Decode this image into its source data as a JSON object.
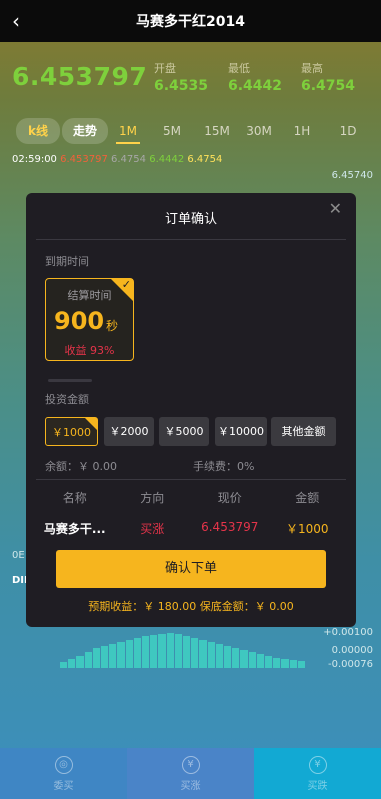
{
  "header": {
    "back_icon": "chevron-left-icon",
    "title": "马赛多干红2014"
  },
  "price": {
    "current": "6.453797",
    "open_label": "开盘",
    "open": "6.4535",
    "low_label": "最低",
    "low": "6.4442",
    "high_label": "最高",
    "high": "6.4754"
  },
  "tabs": [
    "k线",
    "走势",
    "1M",
    "5M",
    "15M",
    "30M",
    "1H",
    "1D"
  ],
  "ticker": {
    "time": "02:59:00",
    "open": "6.453797",
    "high": "6.4754",
    "low": "6.4442",
    "close": "6.4754"
  },
  "axis": {
    "top": "6.45740",
    "r1": "+0.00100",
    "r2": "0.00000",
    "r3": "-0.00076"
  },
  "chart_fragment": {
    "left_a": "0E",
    "left_b": "DII"
  },
  "bottom_nav": [
    "委买",
    "买涨",
    "买跌"
  ],
  "modal": {
    "title": "订单确认",
    "close_icon": "close-icon",
    "expiry_label": "到期时间",
    "time_card": {
      "label": "结算时间",
      "value": "900",
      "unit": "秒",
      "yield": "收益 93%"
    },
    "amount_label": "投资金额",
    "amounts": [
      "￥1000",
      "￥2000",
      "￥5000",
      "￥10000",
      "其他金额"
    ],
    "balance": "余额：￥ 0.00",
    "fee": "手续费：0%",
    "table": {
      "headers": [
        "名称",
        "方向",
        "现价",
        "金额"
      ],
      "row": {
        "name": "马赛多干...",
        "direction": "买涨",
        "price": "6.453797",
        "amount": "￥1000"
      }
    },
    "confirm_label": "确认下单",
    "summary": "预期收益：￥ 180.00   保底金额：￥ 0.00"
  },
  "colors": {
    "accent": "#f6b51e",
    "up": "#e5344a",
    "price_green": "#7ed03c",
    "modal_bg": "#1f1d23"
  }
}
